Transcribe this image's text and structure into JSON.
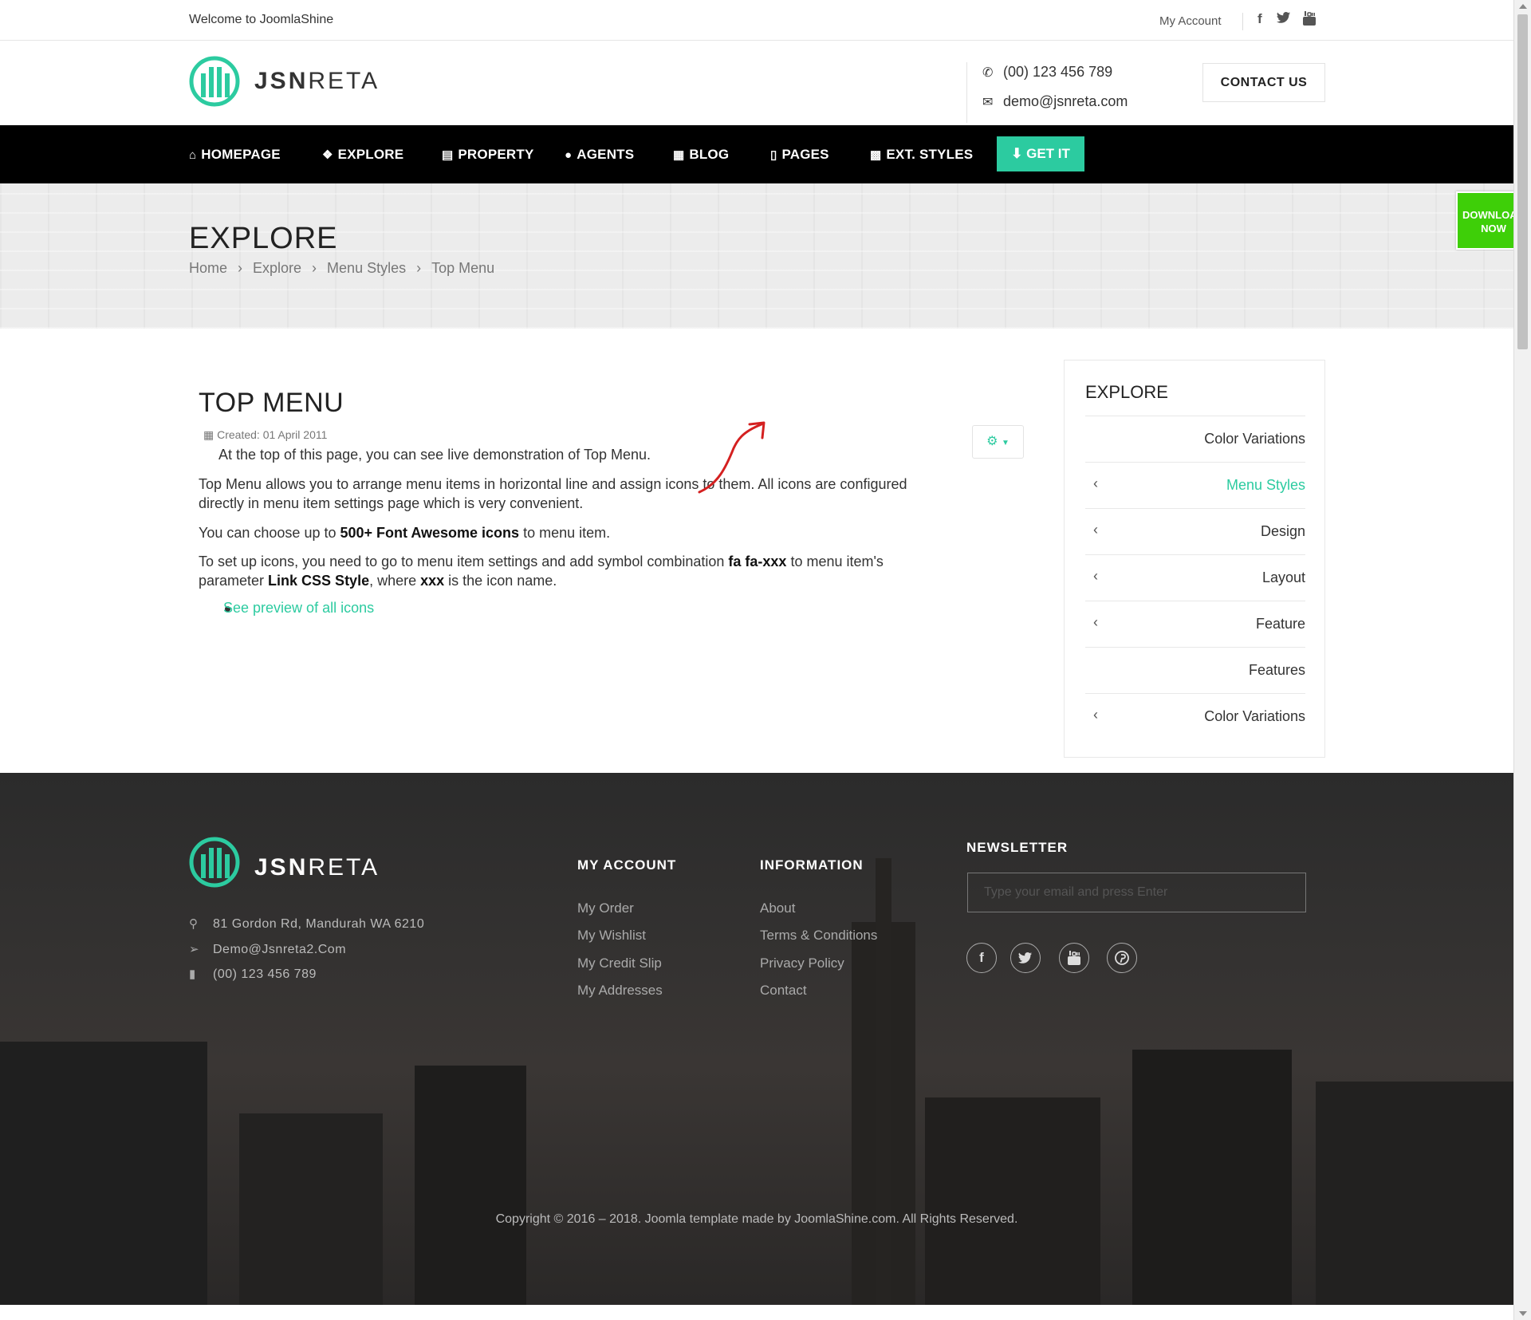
{
  "topbar": {
    "welcome": "Welcome to JoomlaShine",
    "account": "My Account",
    "social": [
      "facebook-icon",
      "twitter-icon",
      "youtube-icon"
    ]
  },
  "header": {
    "logo_bold": "JSN",
    "logo_light": "RETA",
    "phone": "(00) 123 456 789",
    "email": "demo@jsnreta.com",
    "contact_label": "CONTACT US"
  },
  "nav": {
    "items": [
      {
        "label": "HOMEPAGE",
        "icon": "home-icon"
      },
      {
        "label": "EXPLORE",
        "icon": "cubes-icon"
      },
      {
        "label": "PROPERTY",
        "icon": "building-icon"
      },
      {
        "label": "AGENTS",
        "icon": "user-icon"
      },
      {
        "label": "BLOG",
        "icon": "newspaper-icon"
      },
      {
        "label": "PAGES",
        "icon": "file-icon"
      },
      {
        "label": "EXT. STYLES",
        "icon": "grid-icon"
      }
    ],
    "getit": "GET IT"
  },
  "download": {
    "line1": "DOWNLOAD",
    "line2": "NOW"
  },
  "banner": {
    "title": "EXPLORE",
    "breadcrumb": [
      "Home",
      "Explore",
      "Menu Styles",
      "Top Menu"
    ]
  },
  "article": {
    "title": "TOP MENU",
    "created": "Created: 01 April 2011",
    "p1": "At the top of this page, you can see live demonstration of Top Menu.",
    "p2a": "Top Menu allows you to arrange menu items in horizontal line and assign icons to them. All icons are configured",
    "p2b": "directly in menu item settings page which is very convenient.",
    "p3_pre": "You can choose up to ",
    "p3_bold": "500+ Font Awesome icons",
    "p3_post": " to menu item.",
    "p4_pre": "To set up icons, you need to go to menu item settings and add symbol combination ",
    "p4_bold1": "fa fa-xxx",
    "p4_mid": " to menu item's",
    "p4b_pre": "parameter ",
    "p4b_bold": "Link CSS Style",
    "p4b_mid": ", where ",
    "p4b_bold2": "xxx",
    "p4b_post": " is the icon name.",
    "link": "See preview of all icons"
  },
  "sidebar": {
    "title": "EXPLORE",
    "items": [
      {
        "label": "Color Variations",
        "chevron": false,
        "active": false
      },
      {
        "label": "Menu Styles",
        "chevron": true,
        "active": true
      },
      {
        "label": "Design",
        "chevron": true,
        "active": false
      },
      {
        "label": "Layout",
        "chevron": true,
        "active": false
      },
      {
        "label": "Feature",
        "chevron": true,
        "active": false
      },
      {
        "label": "Features",
        "chevron": false,
        "active": false
      },
      {
        "label": "Color Variations",
        "chevron": true,
        "active": false
      }
    ],
    "chevron_glyph": "‹"
  },
  "footer": {
    "logo_bold": "JSN",
    "logo_light": "RETA",
    "address": "81 Gordon Rd, Mandurah WA 6210",
    "email": "Demo@Jsnreta2.Com",
    "phone": "(00) 123 456 789",
    "my_account": {
      "title": "MY ACCOUNT",
      "links": [
        "My Order",
        "My Wishlist",
        "My Credit Slip",
        "My Addresses"
      ]
    },
    "information": {
      "title": "INFORMATION",
      "links": [
        "About",
        "Terms & Conditions",
        "Privacy Policy",
        "Contact"
      ]
    },
    "newsletter": {
      "title": "NEWSLETTER",
      "placeholder": "Type your email and press Enter"
    },
    "social": [
      "facebook-icon",
      "twitter-icon",
      "youtube-icon",
      "pinterest-icon"
    ],
    "copyright": "Copyright © 2016 – 2018. Joomla template made by JoomlaShine.com. All Rights Reserved."
  },
  "colors": {
    "accent": "#2ccba0",
    "nav_bg": "#000000",
    "download_bg": "#3ecf08",
    "footer_bg": "#2c2c2c"
  }
}
